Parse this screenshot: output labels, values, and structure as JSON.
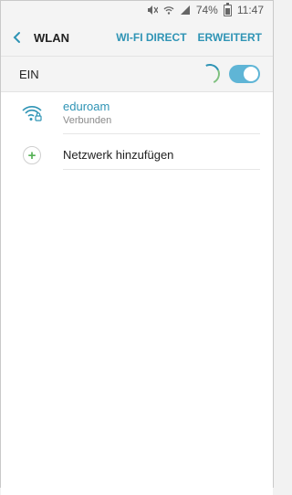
{
  "statusbar": {
    "battery": "74%",
    "time": "11:47"
  },
  "appbar": {
    "title": "WLAN",
    "action1": "WI-FI DIRECT",
    "action2": "ERWEITERT"
  },
  "master": {
    "label": "EIN"
  },
  "networks": [
    {
      "name": "eduroam",
      "status": "Verbunden"
    }
  ],
  "add_network": {
    "label": "Netzwerk hinzufügen"
  },
  "colors": {
    "accent": "#2f94b5",
    "toggle": "#5fb5d6",
    "plus": "#55b155"
  }
}
